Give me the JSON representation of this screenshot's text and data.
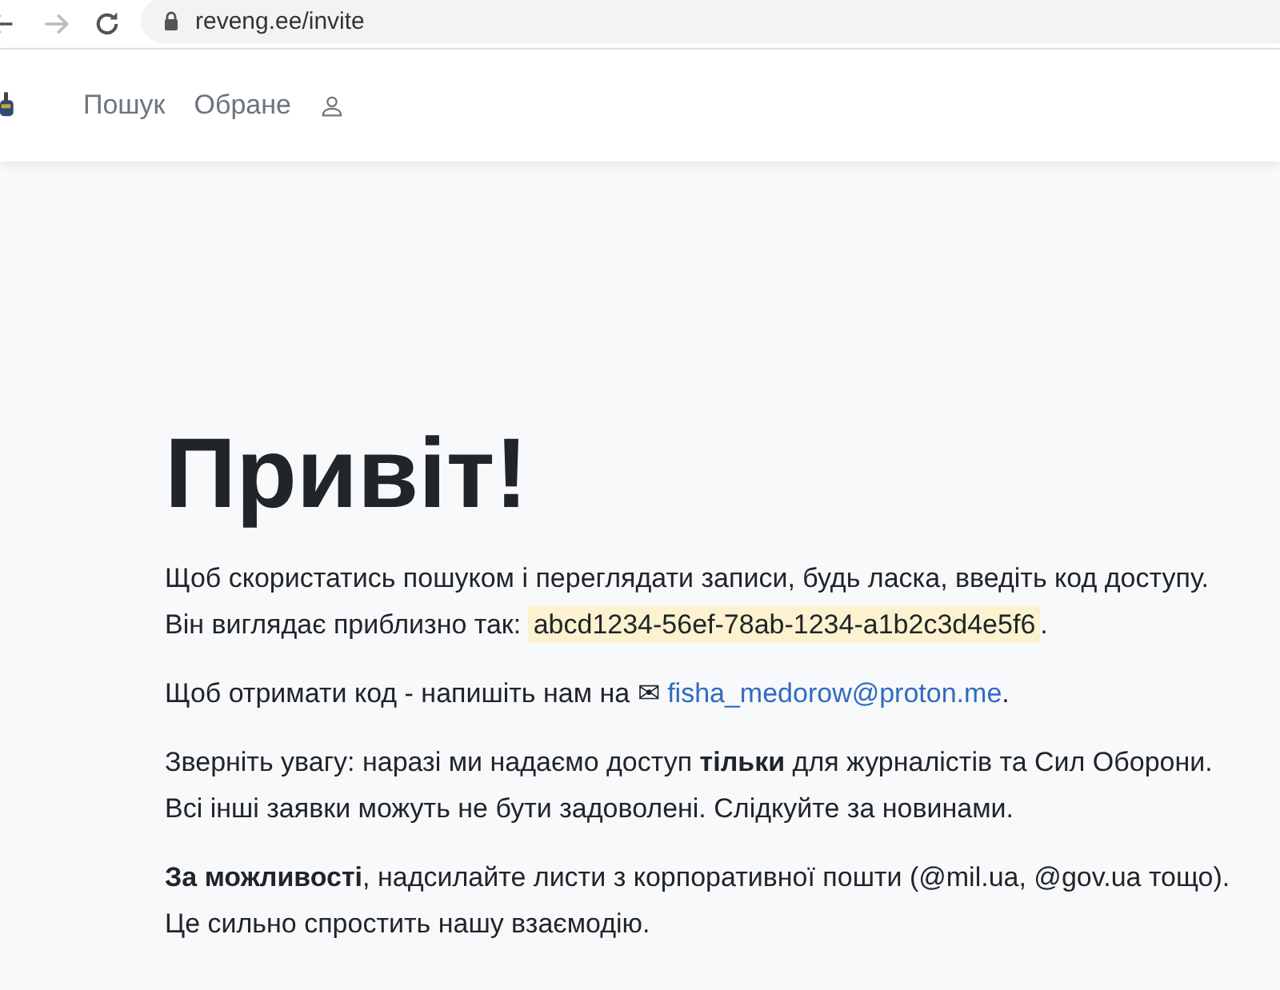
{
  "browser": {
    "url": "reveng.ee/invite"
  },
  "nav": {
    "links": [
      {
        "label": "Пошук"
      },
      {
        "label": "Обране"
      }
    ]
  },
  "heading": "Привіт!",
  "paragraphs": [
    {
      "kind": "code",
      "text": "Щоб скористатись пошуком і переглядати записи, будь ласка, введіть код доступу. Він виглядає приблизно так: ",
      "code": "abcd1234-56ef-78ab-1234-a1b2c3d4e5f6",
      "after": "."
    },
    {
      "kind": "email",
      "text": "Щоб отримати код - напишіть нам на ",
      "icon": "✉",
      "link": "fisha_medorow@proton.me",
      "after": "."
    },
    {
      "kind": "plain",
      "text": "Зверніть увагу: наразі ми надаємо доступ **тільки** для журналістів та Сил Оборони. Всі інші заявки можуть не бути задоволені. Слідкуйте за новинами."
    },
    {
      "kind": "plain",
      "text": "**За можливості**, надсилайте листи з корпоративної пошти (@mil.ua, @gov.ua тощо). Це сильно спростить нашу взаємодію."
    }
  ]
}
